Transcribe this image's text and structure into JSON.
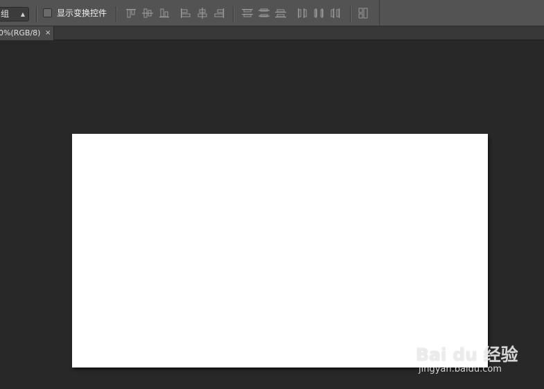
{
  "options_bar": {
    "dropdown_value": "组",
    "show_transform_controls_label": "显示变换控件",
    "show_transform_controls_checked": false,
    "align_icons": [
      "align-top-edges-icon",
      "align-vertical-centers-icon",
      "align-bottom-edges-icon",
      "align-left-edges-icon",
      "align-horizontal-centers-icon",
      "align-right-edges-icon"
    ],
    "distribute_icons": [
      "distribute-top-edges-icon",
      "distribute-vertical-centers-icon",
      "distribute-bottom-edges-icon",
      "distribute-left-edges-icon",
      "distribute-horizontal-centers-icon",
      "distribute-right-edges-icon"
    ],
    "auto_align_icon": "auto-align-layers-icon"
  },
  "document_tab": {
    "title": "0%(RGB/8)",
    "close_glyph": "×"
  },
  "watermark": {
    "brand": "Bai du 经验",
    "url": "jingyan.baidu.com"
  },
  "colors": {
    "options_bar_bg": "#535353",
    "workspace_bg": "#282828",
    "document_bg": "#ffffff"
  }
}
